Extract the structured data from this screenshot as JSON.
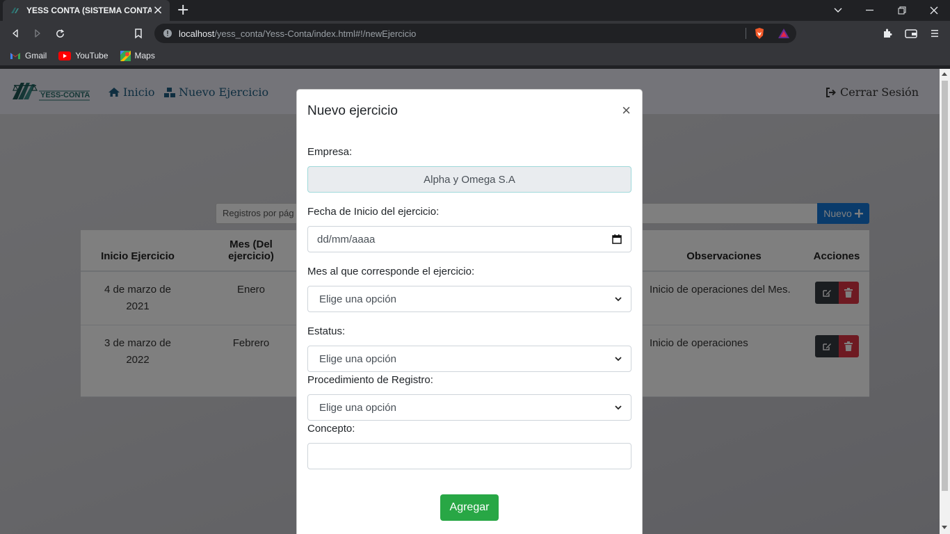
{
  "browser": {
    "tab_title": "YESS CONTA (SISTEMA CONTABLE",
    "tab_close": "×",
    "new_tab": "+",
    "url_host": "localhost",
    "url_path": "/yess_conta/Yess-Conta/index.html#!/newEjercicio",
    "bookmarks": [
      {
        "label": "Gmail",
        "icon": "gmail-icon"
      },
      {
        "label": "YouTube",
        "icon": "youtube-icon"
      },
      {
        "label": "Maps",
        "icon": "maps-icon"
      }
    ]
  },
  "app": {
    "logo_text": "YESS-CONTA",
    "nav": {
      "home": "Inicio",
      "new_exercise": "Nuevo Ejercicio",
      "logout": "Cerrar Sesión"
    },
    "records_placeholder": "Registros por pág",
    "new_button": "Nuevo",
    "table": {
      "headers": {
        "start": "Inicio Ejercicio",
        "month": "Mes (Del ejercicio)",
        "observations": "Observaciones",
        "actions": "Acciones"
      },
      "rows": [
        {
          "start": "4 de marzo de 2021",
          "month": "Enero",
          "observations": "Inicio de operaciones del Mes."
        },
        {
          "start": "3 de marzo de 2022",
          "month": "Febrero",
          "observations": "Inicio de operaciones"
        }
      ]
    }
  },
  "modal": {
    "title": "Nuevo ejercicio",
    "close": "×",
    "company_label": "Empresa:",
    "company_value": "Alpha y Omega S.A",
    "date_label": "Fecha de Inicio del ejercicio:",
    "date_placeholder": "dd/mm/aaaa",
    "month_label": "Mes al que corresponde el ejercicio:",
    "month_value": "Elige una opción",
    "status_label": "Estatus:",
    "status_value": "Elige una opción",
    "procedure_label": "Procedimiento de Registro:",
    "procedure_value": "Elige una opción",
    "concept_label": "Concepto:",
    "concept_value": "",
    "submit": "Agregar"
  },
  "colors": {
    "nav_link": "#1e5c80",
    "new_button": "#1476d6",
    "submit": "#28a745",
    "delete": "#dc3545",
    "edit": "#343a40"
  }
}
